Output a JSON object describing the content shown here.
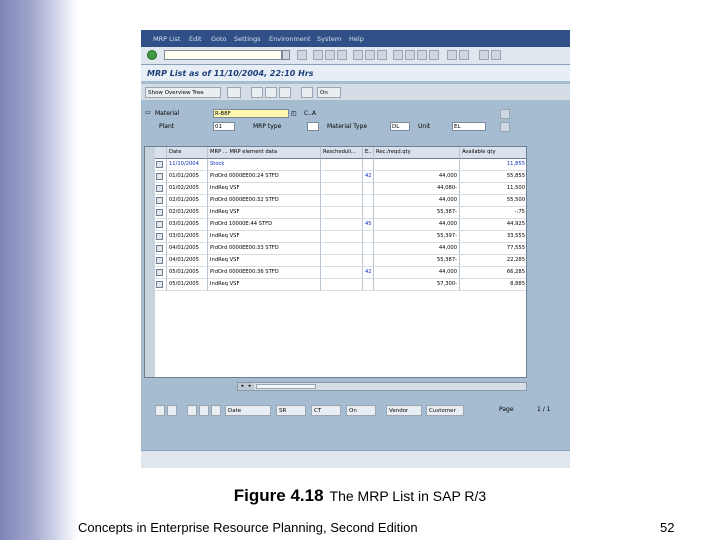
{
  "window": {
    "menu": [
      "MRP List",
      "Edit",
      "Goto",
      "Settings",
      "Environment",
      "System",
      "Help"
    ],
    "screen_title": "MRP List as of 11/10/2004, 22:10 Hrs"
  },
  "app_toolbar": {
    "show_overview_tree": "Show Overview Tree",
    "on": "On"
  },
  "header": {
    "material_label": "Material",
    "material_value": "R-B8F",
    "material_desc": "C..A",
    "plant_label": "Plant",
    "plant_value": "01",
    "mrp_type_label": "MRP type",
    "material_type_label": "Material Type",
    "material_type_value": "DL",
    "unit_label": "Unit",
    "unit_value": "EL"
  },
  "grid": {
    "columns": [
      "Date",
      "MRP ... MRP element data",
      "Rescheduli...",
      "E..",
      "Rec./reqd.qty",
      "Available qty"
    ],
    "rows": [
      {
        "date": "11/10/2004",
        "element": "Stock",
        "resched": "",
        "exc": "",
        "qty": "",
        "avail": "11,855"
      },
      {
        "date": "01/01/2005",
        "element": "PldOrd 0000EE00:24 STFD",
        "resched": "",
        "exc": "42",
        "qty": "44,000",
        "avail": "55,855"
      },
      {
        "date": "01/02/2005",
        "element": "IndReq VSF",
        "resched": "",
        "exc": "",
        "qty": "44,080-",
        "avail": "11,500"
      },
      {
        "date": "02/01/2005",
        "element": "PldOrd 0000EE00:32 STFD",
        "resched": "",
        "exc": "",
        "qty": "44,000",
        "avail": "55,500"
      },
      {
        "date": "02/01/2005",
        "element": "IndReq VSF",
        "resched": "",
        "exc": "",
        "qty": "55,387-",
        "avail": "-:75"
      },
      {
        "date": "03/01/2005",
        "element": "PldOrd 10000E:44 STFD",
        "resched": "",
        "exc": "45",
        "qty": "44,000",
        "avail": "44,925"
      },
      {
        "date": "03/01/2005",
        "element": "IndReq VSF",
        "resched": "",
        "exc": "",
        "qty": "55,397-",
        "avail": "33,555"
      },
      {
        "date": "04/01/2005",
        "element": "PldOrd 0000EE00:33 STFD",
        "resched": "",
        "exc": "",
        "qty": "44,000",
        "avail": "77,555"
      },
      {
        "date": "04/01/2005",
        "element": "IndReq VSF",
        "resched": "",
        "exc": "",
        "qty": "55,387-",
        "avail": "22,285"
      },
      {
        "date": "05/01/2005",
        "element": "PldOrd 0000EE00:36 STFD",
        "resched": "",
        "exc": "42",
        "qty": "44,000",
        "avail": "66,285"
      },
      {
        "date": "05/01/2005",
        "element": "IndReq VSF",
        "resched": "",
        "exc": "",
        "qty": "57,300-",
        "avail": "8,885"
      }
    ]
  },
  "bottom_toolbar": {
    "date": "Date",
    "sr": "SR",
    "ct": "CT",
    "on": "On",
    "vendor": "Vendor",
    "customer": "Customer",
    "page_label": "Page",
    "page_value": "1 / 1"
  },
  "caption": {
    "figure": "Figure 4.18",
    "title": "The MRP List in SAP R/3"
  },
  "footer": {
    "book": "Concepts in Enterprise Resource Planning, Second Edition",
    "page": "52"
  }
}
